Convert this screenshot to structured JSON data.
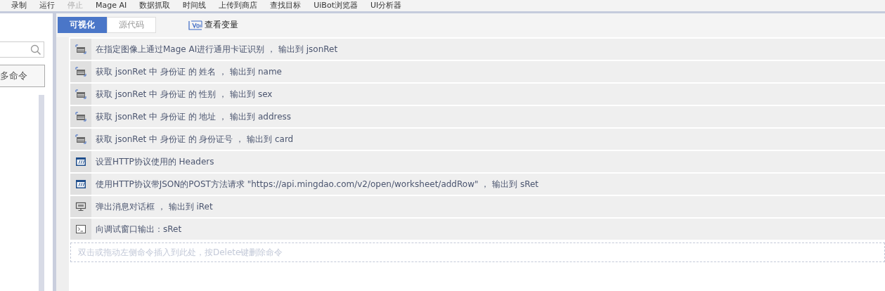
{
  "toolbar": [
    {
      "label": "录制",
      "disabled": false
    },
    {
      "label": "运行",
      "disabled": false
    },
    {
      "label": "停止",
      "disabled": true
    },
    {
      "label": "Mage AI",
      "disabled": false
    },
    {
      "label": "数据抓取",
      "disabled": false
    },
    {
      "label": "时间线",
      "disabled": false
    },
    {
      "label": "上传到商店",
      "disabled": false
    },
    {
      "label": "查找目标",
      "disabled": false
    },
    {
      "label": "UiBot浏览器",
      "disabled": false
    },
    {
      "label": "UI分析器",
      "disabled": false
    }
  ],
  "sidebar": {
    "more_button": "多命令"
  },
  "tabs": [
    {
      "label": "可视化",
      "selected": true
    },
    {
      "label": "源代码",
      "selected": false
    }
  ],
  "view_variables": "查看变量",
  "commands": [
    {
      "kind": "card",
      "text": "在指定图像上通过Mage AI进行通用卡证识别 ， 输出到 jsonRet"
    },
    {
      "kind": "card",
      "text": "获取 jsonRet 中 身份证 的 姓名 ， 输出到 name"
    },
    {
      "kind": "card",
      "text": "获取 jsonRet 中 身份证 的 性别 ， 输出到 sex"
    },
    {
      "kind": "card",
      "text": "获取 jsonRet 中 身份证 的 地址 ， 输出到 address"
    },
    {
      "kind": "card",
      "text": "获取 jsonRet 中 身份证 的 身份证号 ， 输出到 card"
    },
    {
      "kind": "http",
      "text": "设置HTTP协议使用的 Headers"
    },
    {
      "kind": "http",
      "text": "使用HTTP协议带JSON的POST方法请求 \"https://api.mingdao.com/v2/open/worksheet/addRow\" ， 输出到 sRet"
    },
    {
      "kind": "dialog",
      "text": "弹出消息对话框 ， 输出到 iRet"
    },
    {
      "kind": "console",
      "text": "向调试窗口输出：sRet"
    }
  ],
  "drop_hint": "双击或拖动左侧命令插入到此处，按Delete键删除命令"
}
